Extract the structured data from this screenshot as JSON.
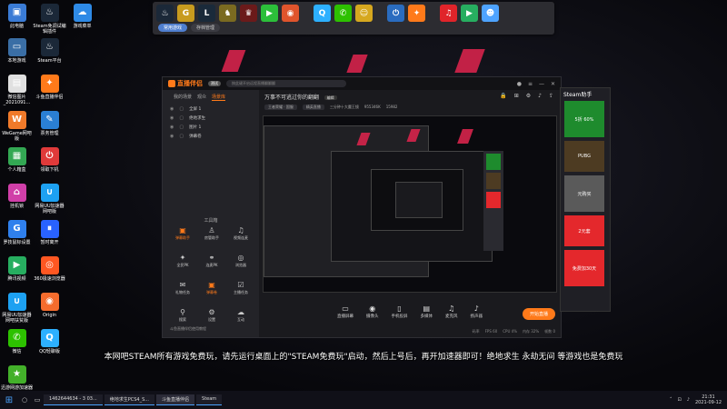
{
  "desktop_icons": [
    {
      "label": "此电脑",
      "icon": "computer-icon",
      "color": "#3a7bd5"
    },
    {
      "label": "Steam免调试编辑插件",
      "icon": "steam-icon",
      "color": "#1b2838"
    },
    {
      "label": "游戏菜单",
      "icon": "cloud-icon",
      "color": "#2e8ae6"
    },
    {
      "label": "本地游戏",
      "icon": "monitor-icon",
      "color": "#3a6ea5"
    },
    {
      "label": "Steam平台",
      "icon": "steam-icon",
      "color": "#1b2838"
    },
    {
      "label": "微信图片_2021091...",
      "icon": "image-icon",
      "color": "#e0e0e0"
    },
    {
      "label": "斗鱼直播伴侣",
      "icon": "huya-icon",
      "color": "#ff7a1a"
    },
    {
      "label": "WeGame网吧版",
      "icon": "wegame-icon",
      "color": "#f07a2a"
    },
    {
      "label": "票务管理",
      "icon": "ticket-icon",
      "color": "#2a7fd4"
    },
    {
      "label": "个人箱盒",
      "icon": "box-icon",
      "color": "#33a853"
    },
    {
      "label": "领取下机",
      "icon": "power-icon",
      "color": "#e03a3a"
    },
    {
      "label": "挂机锁",
      "icon": "lock-icon",
      "color": "#d03fa8"
    },
    {
      "label": "网易UU加速器网吧版",
      "icon": "uu-icon",
      "color": "#1da1f2"
    },
    {
      "label": "罗技鼠标设置",
      "icon": "logitech-icon",
      "color": "#2f80ed"
    },
    {
      "label": "暂时离开",
      "icon": "pause-icon",
      "color": "#2962ff"
    },
    {
      "label": "腾讯视频",
      "icon": "video-icon",
      "color": "#27ae60"
    },
    {
      "label": "360极速浏览器",
      "icon": "browser-icon",
      "color": "#ff5722"
    },
    {
      "label": "网易UU加速器网吧扶贫版",
      "icon": "uu-icon",
      "color": "#1da1f2"
    },
    {
      "label": "Origin",
      "icon": "origin-icon",
      "color": "#f56c2d"
    },
    {
      "label": "微信",
      "icon": "wechat-icon",
      "color": "#2dc100"
    },
    {
      "label": "QQ轻聊版",
      "icon": "qq-icon",
      "color": "#2db0ff"
    },
    {
      "label": "迅游网游加速器",
      "icon": "xunyou-icon",
      "color": "#43b02a"
    }
  ],
  "dock": {
    "tabs": [
      {
        "label": "常用游戏",
        "active": true
      },
      {
        "label": "存档管理",
        "active": false
      }
    ]
  },
  "main_window": {
    "app_name": "直播伴侣",
    "badge": "测试",
    "search_placeholder": "按此键开启远程直播翻翻翻",
    "side_tabs": [
      "我的场景",
      "观众",
      "场景库"
    ],
    "layers": [
      "全屏 1",
      "绝地求生",
      "图片 1",
      "弹幕卷"
    ],
    "tools_title": "工具箱",
    "tools": [
      {
        "label": "弹幕助手",
        "icon": "danmaku-icon",
        "active": true
      },
      {
        "label": "房管助手",
        "icon": "user-icon",
        "active": false
      },
      {
        "label": "视频连麦",
        "icon": "mic-icon",
        "active": false
      },
      {
        "label": "全民PK",
        "icon": "pk-icon",
        "active": false
      },
      {
        "label": "连麦PK",
        "icon": "link-icon",
        "active": false
      },
      {
        "label": "浏览器",
        "icon": "browser-icon",
        "active": false
      },
      {
        "label": "礼物任务",
        "icon": "gift-icon",
        "active": false
      },
      {
        "label": "弹幕卷",
        "icon": "danmaku-icon",
        "active": true
      },
      {
        "label": "主播任务",
        "icon": "task-icon",
        "active": false
      },
      {
        "label": "搜索",
        "icon": "search-icon",
        "active": false
      },
      {
        "label": "设置",
        "icon": "gear-icon",
        "active": false
      },
      {
        "label": "互动",
        "icon": "cloud-icon",
        "active": false
      }
    ],
    "side_footer": "斗鱼直播伴侣使用教程",
    "stream_title": "万事不可逃过你的翻翻",
    "edit_badge": "编辑",
    "stream_meta": [
      {
        "text": "王者荣耀 · 国服",
        "tag": true
      },
      {
        "text": "精英直播",
        "tag": true
      },
      {
        "text": "三分钟十大魔王镜",
        "tag": false
      },
      {
        "text": "955346K",
        "tag": false
      },
      {
        "text": "15982",
        "tag": false
      }
    ],
    "bottom_buttons": [
      {
        "label": "直播屏幕",
        "icon": "screen-icon"
      },
      {
        "label": "摄像头",
        "icon": "camera-icon"
      },
      {
        "label": "手机投屏",
        "icon": "phone-icon"
      },
      {
        "label": "多媒体",
        "icon": "media-icon"
      },
      {
        "label": "麦克风",
        "icon": "mic-icon"
      },
      {
        "label": "扬声器",
        "icon": "speaker-icon"
      }
    ],
    "live_button": "开始直播",
    "stats": [
      "码率",
      "FPS 60",
      "CPU 4%",
      "内存 32%",
      "帧数 0"
    ]
  },
  "steam_panel": {
    "header": "Steam助手",
    "tiles": [
      {
        "text": "5折 60%",
        "color": "#1e8b2d"
      },
      {
        "text": "PUBG",
        "color": "#4d3b22"
      },
      {
        "text": "元购买",
        "color": "#5a5a5a"
      },
      {
        "text": "2元套",
        "color": "#e4282c"
      },
      {
        "text": "免费加30天",
        "color": "#e4282c"
      }
    ]
  },
  "subtitle": "本网吧STEAM所有游戏免费玩，请先运行桌面上的\"STEAM免费玩\"启动，然后上号后，再开加速器即可！绝地求生 永劫无间 等游戏也是免费玩",
  "taskbar": {
    "items": [
      {
        "label": "1462644634 - 3 03...",
        "active": false
      },
      {
        "label": "绝地求生PCS4_S...",
        "active": false
      },
      {
        "label": "斗鱼直播伴侣",
        "active": true
      },
      {
        "label": "Steam",
        "active": false
      }
    ],
    "time": "21:31",
    "date": "2021-09-12"
  }
}
